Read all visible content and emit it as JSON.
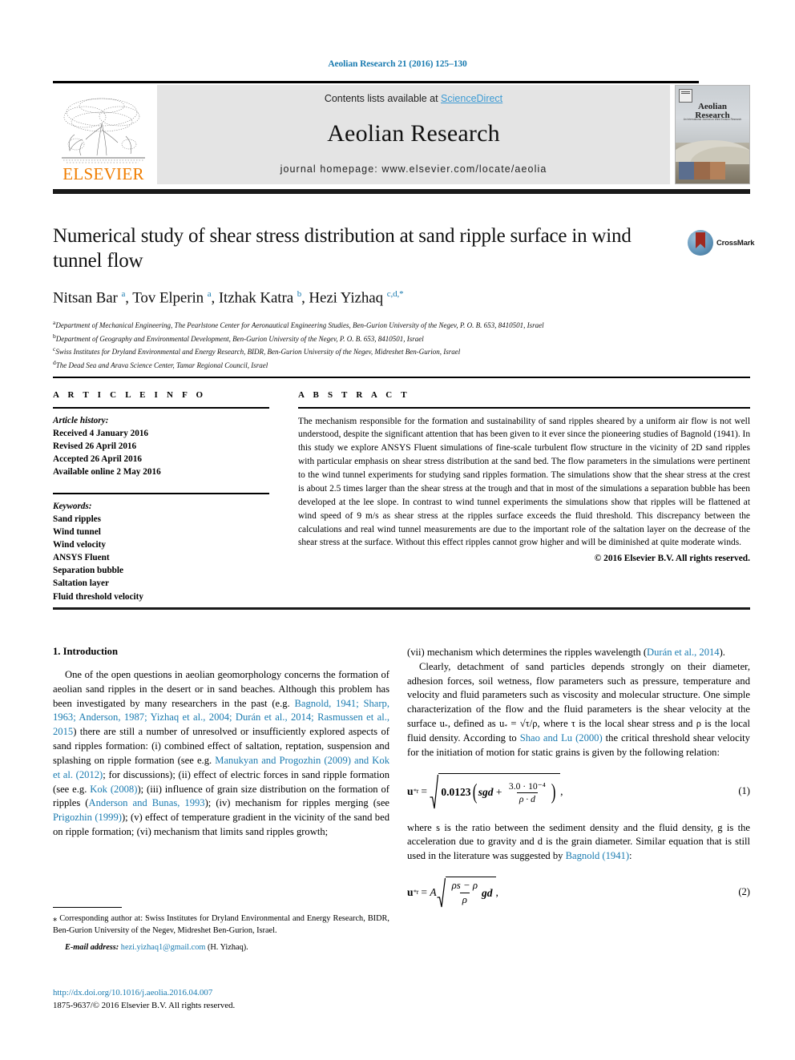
{
  "running_head": "Aeolian Research 21 (2016) 125–130",
  "masthead": {
    "elsevier_wordmark": "ELSEVIER",
    "contents_prefix": "Contents lists available at ",
    "contents_link": "ScienceDirect",
    "journal_title": "Aeolian Research",
    "homepage": "journal homepage: www.elsevier.com/locate/aeolia",
    "cover_title_line1": "Aeolian",
    "cover_title_line2": "Research",
    "cover_subtitle": "An International Journal on Wind Erosion Research"
  },
  "article": {
    "title": "Numerical study of shear stress distribution at sand ripple surface in wind tunnel flow",
    "crossmark_label": "CrossMark",
    "authors_html": "Nitsan Bar <sup>a</sup>, Tov Elperin <sup>a</sup>, Itzhak Katra <sup>b</sup>, Hezi Yizhaq <sup>c,d,</sup><sup>*</sup>",
    "affiliations": [
      {
        "mark": "a",
        "text": "Department of Mechanical Engineering, The Pearlstone Center for Aeronautical Engineering Studies, Ben-Gurion University of the Negev, P. O. B. 653, 8410501, Israel"
      },
      {
        "mark": "b",
        "text": "Department of Geography and Environmental Development, Ben-Gurion University of the Negev, P. O. B. 653, 8410501, Israel"
      },
      {
        "mark": "c",
        "text": "Swiss Institutes for Dryland Environmental and Energy Research, BIDR, Ben-Gurion University of the Negev, Midreshet Ben-Gurion, Israel"
      },
      {
        "mark": "d",
        "text": "The Dead Sea and Arava Science Center, Tamar Regional Council, Israel"
      }
    ]
  },
  "article_info": {
    "heading": "A R T I C L E   I N F O",
    "history_label": "Article history:",
    "history": [
      "Received 4 January 2016",
      "Revised 26 April 2016",
      "Accepted 26 April 2016",
      "Available online 2 May 2016"
    ],
    "keywords_label": "Keywords:",
    "keywords": [
      "Sand ripples",
      "Wind tunnel",
      "Wind velocity",
      "ANSYS Fluent",
      "Separation bubble",
      "Saltation layer",
      "Fluid threshold velocity"
    ]
  },
  "abstract": {
    "heading": "A B S T R A C T",
    "text": "The mechanism responsible for the formation and sustainability of sand ripples sheared by a uniform air flow is not well understood, despite the significant attention that has been given to it ever since the pioneering studies of Bagnold (1941). In this study we explore ANSYS Fluent simulations of fine-scale turbulent flow structure in the vicinity of 2D sand ripples with particular emphasis on shear stress distribution at the sand bed. The flow parameters in the simulations were pertinent to the wind tunnel experiments for studying sand ripples formation. The simulations show that the shear stress at the crest is about 2.5 times larger than the shear stress at the trough and that in most of the simulations a separation bubble has been developed at the lee slope. In contrast to wind tunnel experiments the simulations show that ripples will be flattened at wind speed of 9 m/s as shear stress at the ripples surface exceeds the fluid threshold. This discrepancy between the calculations and real wind tunnel measurements are due to the important role of the saltation layer on the decrease of the shear stress at the surface. Without this effect ripples cannot grow higher and will be diminished at quite moderate winds.",
    "copyright": "© 2016 Elsevier B.V. All rights reserved."
  },
  "body": {
    "section_heading": "1. Introduction",
    "left_p1_a": "One of the open questions in aeolian geomorphology concerns the formation of aeolian sand ripples in the desert or in sand beaches. Although this problem has been investigated by many researchers in the past (e.g. ",
    "left_p1_ref1": "Bagnold, 1941; Sharp, 1963; Anderson, 1987; Yizhaq et al., 2004; Durán et al., 2014; Rasmussen et al., 2015",
    "left_p1_b": ") there are still a number of unresolved or insufficiently explored aspects of sand ripples formation: (i) combined effect of saltation, reptation, suspension and splashing on ripple formation (see e.g. ",
    "left_p1_ref2": "Manukyan and Progozhin (2009) and Kok et al. (2012)",
    "left_p1_c": "; for discussions); (ii) effect of electric forces in sand ripple formation (see e.g. ",
    "left_p1_ref3": "Kok (2008)",
    "left_p1_d": "); (iii) influence of grain size distribution on the formation of ripples (",
    "left_p1_ref4": "Anderson and Bunas, 1993",
    "left_p1_e": "); (iv) mechanism for ripples merging (see ",
    "left_p1_ref5": "Prigozhin (1999)",
    "left_p1_f": "); (v) effect of temperature gradient in the vicinity of the sand bed on ripple formation; (vi) mechanism that limits sand ripples growth;",
    "right_p1_a": "(vii) mechanism which determines the ripples wavelength (",
    "right_p1_ref": "Durán et al., 2014",
    "right_p1_b": ").",
    "right_p2_a": "Clearly, detachment of sand particles depends strongly on their diameter, adhesion forces, soil wetness, flow parameters such as pressure, temperature and velocity and fluid parameters such as viscosity and molecular structure. One simple characterization of the flow and the fluid parameters is the shear velocity at the surface u",
    "right_p2_b": ", defined as u",
    "right_p2_c": " = √τ/ρ, where τ is the local shear stress and ρ is the local fluid density. According to ",
    "right_p2_ref": "Shao and Lu (2000)",
    "right_p2_d": " the critical threshold shear velocity for the initiation of motion for static grains is given by the following relation:",
    "right_p3_a": "where s is the ratio between the sediment density and the fluid density, g is the acceleration due to gravity and d is the grain diameter. Similar equation that is still used in the literature was suggested by ",
    "right_p3_ref": "Bagnold (1941)",
    "right_p3_b": ":"
  },
  "equations": {
    "eq1": {
      "lhs": "u*t",
      "coefficient": "0.0123",
      "term1": "sgd",
      "numerator": "3.0 · 10⁻⁴",
      "denominator": "ρ · d",
      "tail": ",",
      "number": "(1)"
    },
    "eq2": {
      "lhs": "u*t",
      "amplitude": "A",
      "numerator": "ρs − ρ",
      "denominator": "ρ",
      "factor": "gd",
      "tail": ",",
      "number": "(2)"
    }
  },
  "footnote": {
    "marker": "⁎",
    "corresponding": " Corresponding author at: Swiss Institutes for Dryland Environmental and Energy Research, BIDR, Ben-Gurion University of the Negev, Midreshet Ben-Gurion, Israel.",
    "email_label": "E-mail address:",
    "email": "hezi.yizhaq1@gmail.com",
    "email_person": "(H. Yizhaq)."
  },
  "footer": {
    "doi": "http://dx.doi.org/10.1016/j.aeolia.2016.04.007",
    "issn_line": "1875-9637/© 2016 Elsevier B.V. All rights reserved."
  },
  "colors": {
    "link": "#1a7bb0",
    "sciencedirect": "#3d9bd4",
    "elsevier_orange": "#f07d00",
    "masthead_bg": "#e4e4e4"
  }
}
